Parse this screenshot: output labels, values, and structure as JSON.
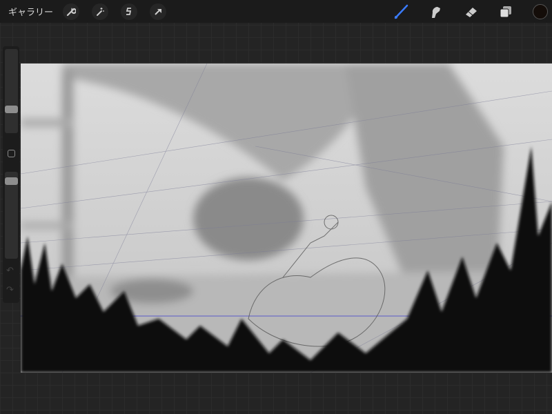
{
  "topbar": {
    "gallery_label": "ギャラリー",
    "left_tools": [
      "wrench-icon",
      "magic-wand-icon",
      "selection-icon",
      "transform-arrow-icon"
    ],
    "right_tools": [
      "brush-icon",
      "smudge-icon",
      "eraser-icon",
      "layers-icon"
    ],
    "accent": "#3a7bff",
    "current_color": "#140d09"
  },
  "sidebar": {
    "brush_size": 0.26,
    "opacity": 0.93,
    "undo_icon": "undo-icon",
    "redo_icon": "redo-icon"
  }
}
